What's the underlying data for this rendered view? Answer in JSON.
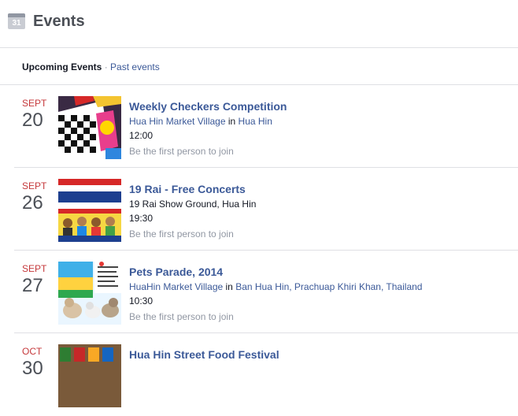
{
  "header": {
    "title": "Events",
    "calendar_icon_number": "31"
  },
  "filters": {
    "upcoming": "Upcoming Events",
    "separator": "·",
    "past": "Past events"
  },
  "events": [
    {
      "month": "SEPT",
      "day": "20",
      "name": "Weekly Checkers Competition",
      "place": "Hua Hin Market Village",
      "connector": "in",
      "area": "Hua Hin",
      "time": "12:00",
      "join": "Be the first person to join"
    },
    {
      "month": "SEPT",
      "day": "26",
      "name": "19 Rai - Free Concerts",
      "location": "19 Rai Show Ground, Hua Hin",
      "time": "19:30",
      "join": "Be the first person to join"
    },
    {
      "month": "SEPT",
      "day": "27",
      "name": "Pets Parade, 2014",
      "place": "HuaHin Market Village",
      "connector": "in",
      "area": "Ban Hua Hin, Prachuap Khiri Khan, Thailand",
      "time": "10:30",
      "join": "Be the first person to join"
    },
    {
      "month": "OCT",
      "day": "30",
      "name": "Hua Hin Street Food Festival"
    }
  ],
  "colors": {
    "link": "#3b5998",
    "month": "#c5383b",
    "muted": "#9197a3"
  }
}
